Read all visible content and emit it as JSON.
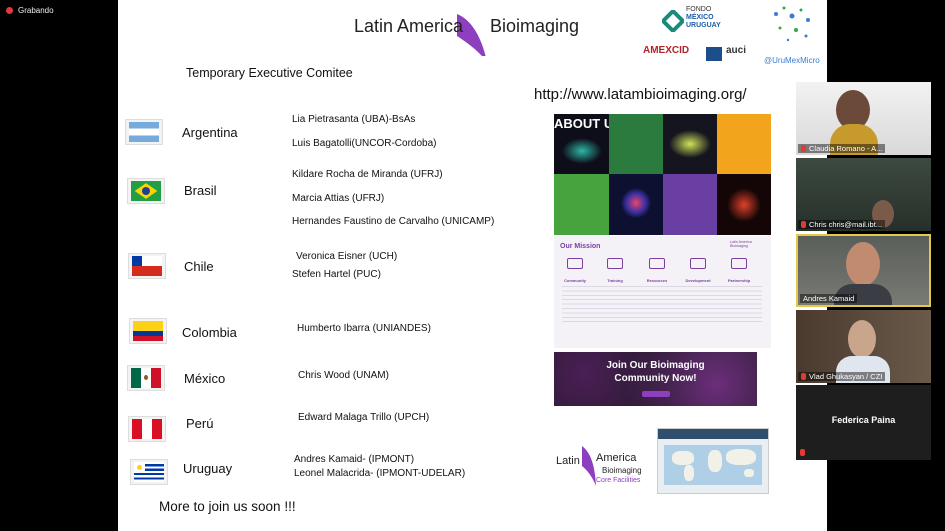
{
  "recording": {
    "label": "Grabando"
  },
  "slide": {
    "logo_left": "Latin America",
    "logo_right": "Bioimaging",
    "fondo": {
      "line1": "FONDO",
      "line2": "MÉXICO",
      "line3": "URUGUAY"
    },
    "amexcid": "AMEXCID",
    "auci": "auci",
    "social": "@UruMexMicro",
    "heading": "Temporary Executive Comitee",
    "url": "http://www.latambioimaging.org/",
    "countries": [
      {
        "name": "Argentina",
        "members": [
          "Lia Pietrasanta (UBA)-BsAs",
          "Luis Bagatolli(UNCOR-Cordoba)"
        ]
      },
      {
        "name": "Brasil",
        "members": [
          "Kildare Rocha de Miranda  (UFRJ)",
          "Marcia Attias (UFRJ)",
          "Hernandes Faustino de Carvalho (UNICAMP)"
        ]
      },
      {
        "name": "Chile",
        "members": [
          "Veronica Eisner (UCH)",
          "Stefen Hartel (PUC)"
        ]
      },
      {
        "name": "Colombia",
        "members": [
          "Humberto Ibarra (UNIANDES)"
        ]
      },
      {
        "name": "México",
        "members": [
          "Chris Wood (UNAM)"
        ]
      },
      {
        "name": "Perú",
        "members": [
          "Edward Malaga Trillo (UPCH)"
        ]
      },
      {
        "name": "Uruguay",
        "members": [
          "Andres Kamaid- (IPMONT)",
          "Leonel Malacrida- (IPMONT-UDELAR)"
        ]
      }
    ],
    "more": "More to join us soon !!!",
    "about": {
      "title": "ABOUT US"
    },
    "mission": {
      "title": "Our Mission",
      "logo": "Latin America Bioimaging",
      "cols": [
        "Community",
        "Training",
        "Resources",
        "Development",
        "Partnership"
      ]
    },
    "join": {
      "line1": "Join Our Bioimaging",
      "line2": "Community Now!"
    },
    "bottom_logo": {
      "line1": "Latin",
      "line2": "America",
      "line3": "Bioimaging",
      "line4": "Core Facilities"
    }
  },
  "participants": [
    {
      "name": "Claudia Romano - A..."
    },
    {
      "name": "Chris chris@mail.ibt..."
    },
    {
      "name": "Andres Kamaid"
    },
    {
      "name": "Vlad Ghukasyan / CZI"
    },
    {
      "name": "Federica Paina"
    }
  ],
  "colors": {
    "purple": "#8e3fbf",
    "mission_purple": "#7b3fa0",
    "about_dark": "#1b1b2e",
    "rec_red": "#e53935"
  }
}
